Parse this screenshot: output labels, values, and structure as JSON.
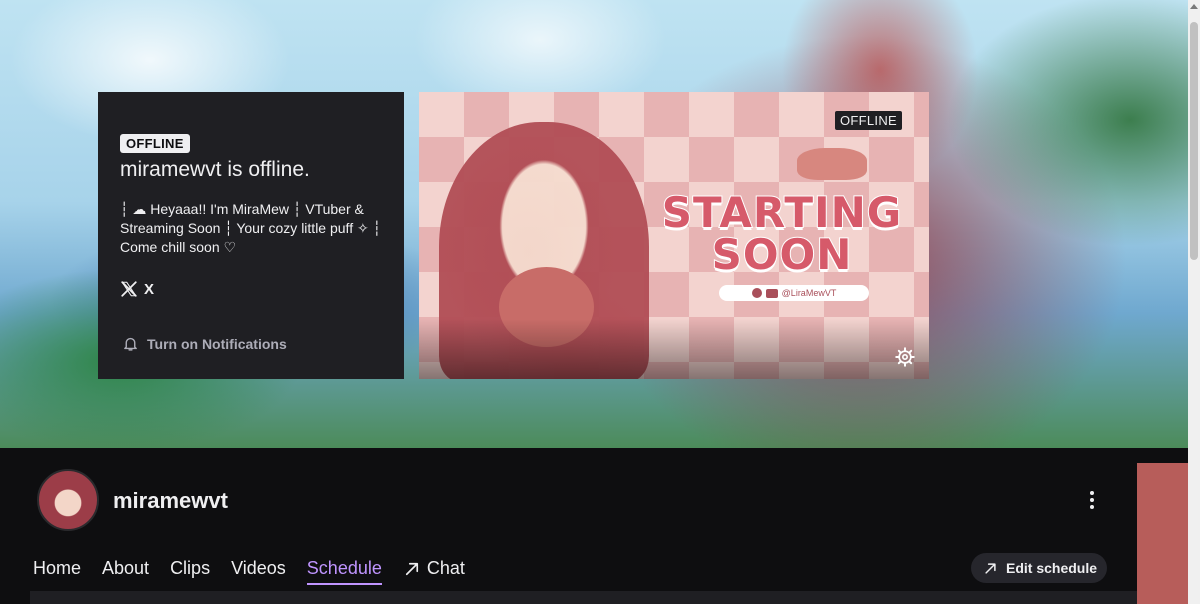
{
  "banner": {
    "info_card": {
      "status_badge": "OFFLINE",
      "title": "miramewvt is offline.",
      "bio": "┆ ☁ Heyaaa!! I'm MiraMew ┆ VTuber & Streaming Soon ┆ Your cozy little puff ✧ ┆ Come chill soon ♡",
      "social_label": "X",
      "notifications_label": "Turn on Notifications"
    },
    "player": {
      "status_badge": "OFFLINE",
      "offline_screen_line1": "STARTING",
      "offline_screen_line2": "SOON",
      "offline_screen_handle": "@LiraMewVT",
      "icons": [
        "paw-icon",
        "x-logo-icon",
        "youtube-icon",
        "gear-icon"
      ]
    }
  },
  "channel": {
    "name": "miramewvt",
    "tabs": [
      {
        "label": "Home",
        "active": false
      },
      {
        "label": "About",
        "active": false
      },
      {
        "label": "Clips",
        "active": false
      },
      {
        "label": "Videos",
        "active": false
      },
      {
        "label": "Schedule",
        "active": true
      },
      {
        "label": "Chat",
        "active": false
      }
    ],
    "edit_schedule_label": "Edit schedule"
  },
  "colors": {
    "accent": "#bf94ff",
    "background": "#0e0e10",
    "card": "#1f1f23",
    "text": "#efeff1",
    "muted": "#adadb8"
  }
}
